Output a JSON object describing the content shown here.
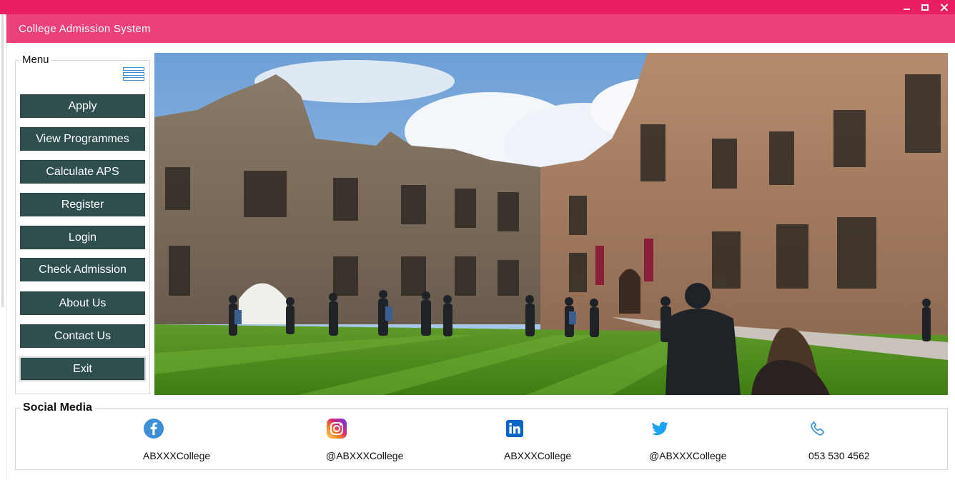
{
  "window": {
    "title": "College Admission System",
    "controls": {
      "minimize_icon": "minimize-icon",
      "maximize_icon": "maximize-icon",
      "close_icon": "close-icon"
    }
  },
  "menu": {
    "legend": "Menu",
    "toggle_icon": "hamburger-icon",
    "items": [
      {
        "label": "Apply"
      },
      {
        "label": "View Programmes"
      },
      {
        "label": "Calculate APS"
      },
      {
        "label": "Register"
      },
      {
        "label": "Login"
      },
      {
        "label": "Check Admission"
      },
      {
        "label": "About Us"
      },
      {
        "label": "Contact Us"
      },
      {
        "label": "Exit"
      }
    ]
  },
  "hero": {
    "image": "college-campus-photo"
  },
  "social": {
    "legend": "Social Media",
    "items": [
      {
        "icon": "facebook-icon",
        "text": "ABXXXCollege",
        "color": "#3b8fd9"
      },
      {
        "icon": "instagram-icon",
        "text": "@ABXXXCollege",
        "color": "#c13584"
      },
      {
        "icon": "linkedin-icon",
        "text": "ABXXXCollege",
        "color": "#0a66c2"
      },
      {
        "icon": "twitter-icon",
        "text": "@ABXXXCollege",
        "color": "#1da1f2"
      },
      {
        "icon": "phone-icon",
        "text": "053 530 4562",
        "color": "#3f8fd8"
      }
    ]
  },
  "colors": {
    "title_bar": "#e91e63",
    "header": "#ec407a",
    "menu_button": "#2f4f4f",
    "menu_button_text": "#ffffff"
  }
}
